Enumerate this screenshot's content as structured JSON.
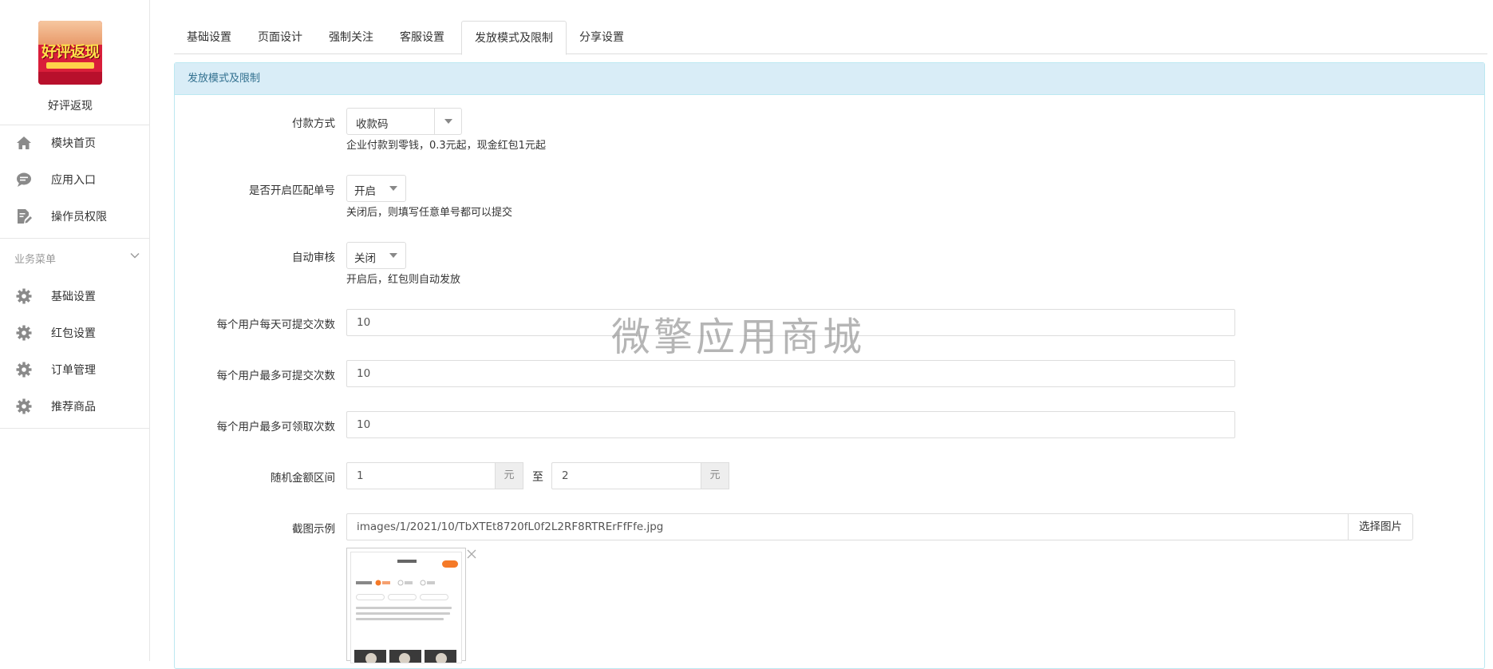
{
  "sidebar": {
    "app_name": "好评返现",
    "logo_text": "好评返现",
    "main_nav": [
      {
        "label": "模块首页",
        "icon": "home-icon"
      },
      {
        "label": "应用入口",
        "icon": "chat-bubble-icon"
      },
      {
        "label": "操作员权限",
        "icon": "edit-document-icon"
      }
    ],
    "section_title": "业务菜单",
    "business_nav": [
      {
        "label": "基础设置",
        "icon": "gear-icon"
      },
      {
        "label": "红包设置",
        "icon": "gear-icon"
      },
      {
        "label": "订单管理",
        "icon": "gear-icon"
      },
      {
        "label": "推荐商品",
        "icon": "gear-icon"
      }
    ]
  },
  "tabs": [
    {
      "label": "基础设置",
      "active": false
    },
    {
      "label": "页面设计",
      "active": false
    },
    {
      "label": "强制关注",
      "active": false
    },
    {
      "label": "客服设置",
      "active": false
    },
    {
      "label": "发放模式及限制",
      "active": true
    },
    {
      "label": "分享设置",
      "active": false
    }
  ],
  "panel": {
    "heading": "发放模式及限制",
    "payment_method": {
      "label": "付款方式",
      "value": "收款码",
      "help": "企业付款到零钱，0.3元起，现金红包1元起"
    },
    "match_order": {
      "label": "是否开启匹配单号",
      "value": "开启",
      "help": "关闭后，则填写任意单号都可以提交"
    },
    "auto_review": {
      "label": "自动审核",
      "value": "关闭",
      "help": "开启后，红包则自动发放"
    },
    "daily_submit": {
      "label": "每个用户每天可提交次数",
      "value": "10"
    },
    "max_submit": {
      "label": "每个用户最多可提交次数",
      "value": "10"
    },
    "max_claim": {
      "label": "每个用户最多可领取次数",
      "value": "10"
    },
    "random_amount": {
      "label": "随机金额区间",
      "min": "1",
      "max": "2",
      "unit": "元",
      "between": "至"
    },
    "screenshot": {
      "label": "截图示例",
      "value": "images/1/2021/10/TbXTEt8720fL0f2L2RF8RTRErFfFfe.jpg",
      "button": "选择图片"
    }
  },
  "watermark": "微擎应用商城",
  "colors": {
    "panel_heading_bg": "#d9edf7",
    "panel_heading_text": "#31708f",
    "panel_border": "#bce8f1"
  }
}
